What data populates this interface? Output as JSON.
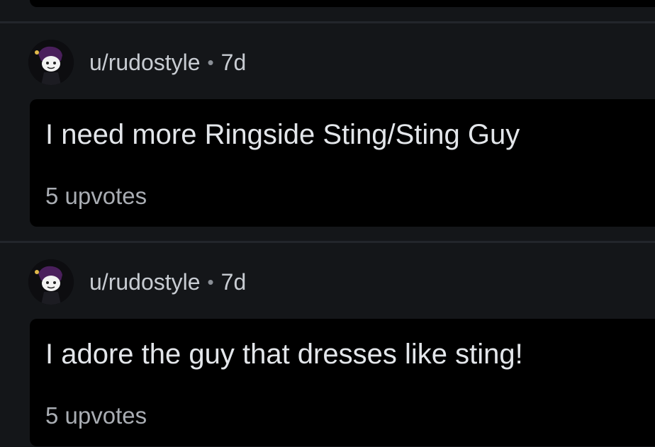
{
  "comments": [
    {
      "username": "u/rudostyle",
      "separator": "•",
      "age": "7d",
      "body": "I need more Ringside Sting/Sting Guy",
      "votes": "5 upvotes",
      "avatar_icon": "user-avatar-icon"
    },
    {
      "username": "u/rudostyle",
      "separator": "•",
      "age": "7d",
      "body": "I adore the guy that dresses like sting!",
      "votes": "5 upvotes",
      "avatar_icon": "user-avatar-icon"
    }
  ],
  "colors": {
    "background": "#141619",
    "card": "#000000",
    "divider": "#23262b",
    "text_primary": "#e3e6ea",
    "text_secondary": "#a9adb3"
  }
}
